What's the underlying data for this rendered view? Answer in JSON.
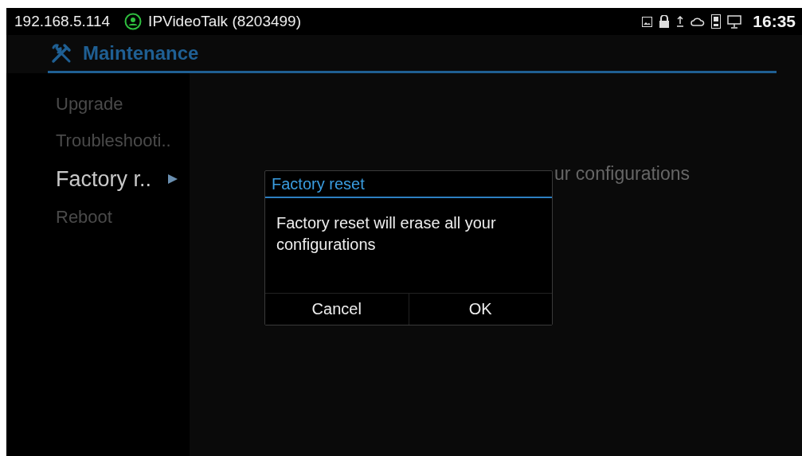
{
  "status_bar": {
    "ip": "192.168.5.114",
    "account": "IPVideoTalk (8203499)",
    "time": "16:35"
  },
  "header": {
    "title": "Maintenance"
  },
  "sidebar": {
    "items": [
      {
        "label": "Upgrade",
        "selected": false
      },
      {
        "label": "Troubleshooti..",
        "selected": false
      },
      {
        "label": "Factory r..",
        "selected": true
      },
      {
        "label": "Reboot",
        "selected": false
      }
    ]
  },
  "content": {
    "description": "ur configurations"
  },
  "dialog": {
    "title": "Factory reset",
    "message": "Factory reset will erase all your configurations",
    "buttons": [
      "Cancel",
      "OK"
    ]
  }
}
